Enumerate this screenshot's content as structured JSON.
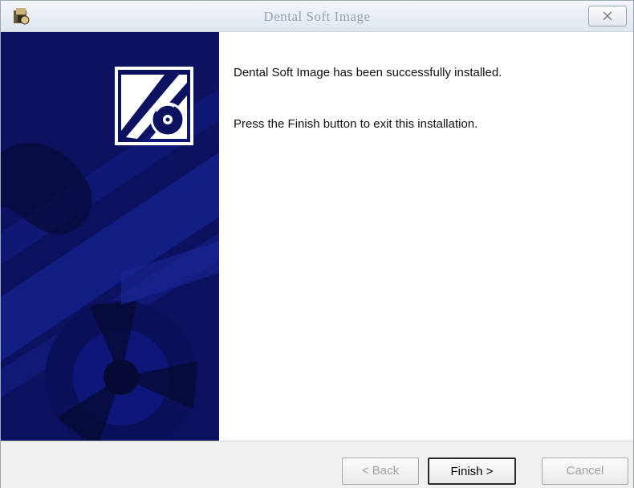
{
  "window": {
    "title": "Dental Soft Image",
    "close_symbol": "⨉"
  },
  "icons": {
    "app": "installer-app-icon",
    "banner": "installer-disc-logo-icon",
    "close": "close-icon"
  },
  "content": {
    "message_installed": "Dental Soft Image has been successfully installed.",
    "message_finish": "Press the Finish button to exit this installation."
  },
  "buttons": {
    "back_label": "< Back",
    "finish_label": "Finish >",
    "cancel_label": "Cancel"
  },
  "colors": {
    "banner_background": "#0c1260",
    "disabled_text": "#a3a3a3"
  }
}
